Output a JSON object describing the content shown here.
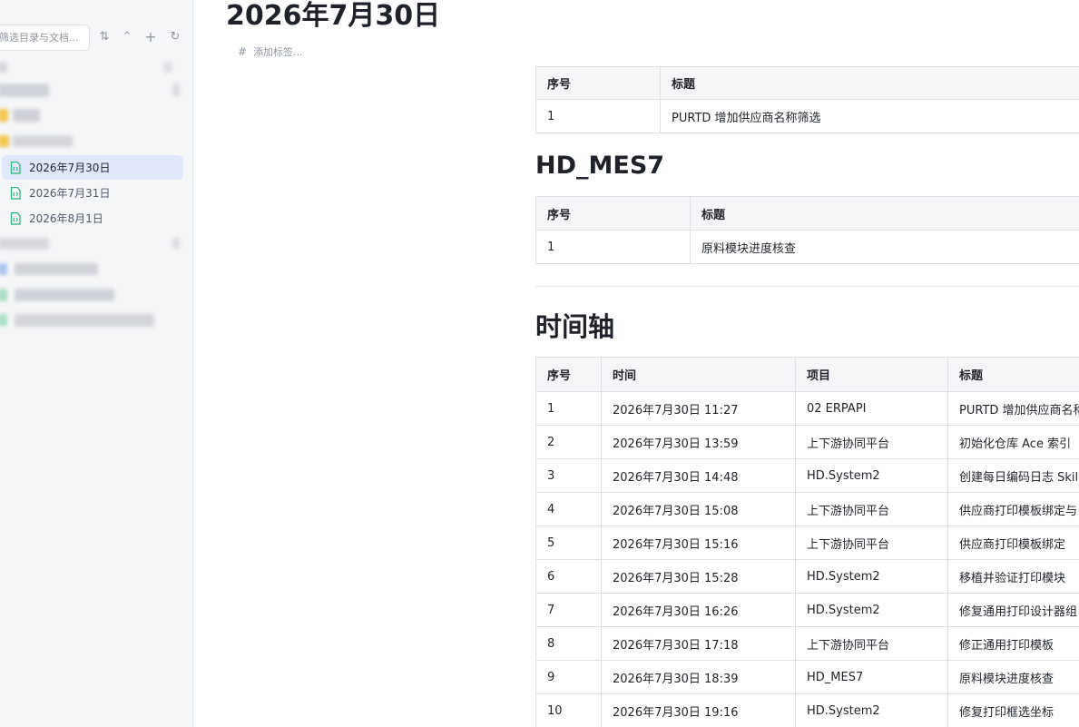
{
  "sidebar": {
    "search": {
      "placeholder": "筛选目录与文档..."
    },
    "docs": [
      {
        "label": "2026年7月30日",
        "active": true
      },
      {
        "label": "2026年7月31日",
        "active": false
      },
      {
        "label": "2026年8月1日",
        "active": false
      }
    ]
  },
  "page": {
    "title": "2026年7月30日",
    "add_tag": "添加标签..."
  },
  "table1": {
    "headers": [
      "序号",
      "标题"
    ],
    "rows": [
      [
        "1",
        "PURTD 增加供应商名称筛选"
      ]
    ]
  },
  "section2": {
    "heading": "HD_MES7",
    "headers": [
      "序号",
      "标题"
    ],
    "rows": [
      [
        "1",
        "原料模块进度核查"
      ]
    ]
  },
  "timeline": {
    "heading": "时间轴",
    "headers": [
      "序号",
      "时间",
      "项目",
      "标题"
    ],
    "rows": [
      [
        "1",
        "2026年7月30日 11:27",
        "02 ERPAPI",
        "PURTD 增加供应商名称筛选"
      ],
      [
        "2",
        "2026年7月30日 13:59",
        "上下游协同平台",
        "初始化仓库 Ace 索引"
      ],
      [
        "3",
        "2026年7月30日 14:48",
        "HD.System2",
        "创建每日编码日志 Skill"
      ],
      [
        "4",
        "2026年7月30日 15:08",
        "上下游协同平台",
        "供应商打印模板绑定与"
      ],
      [
        "5",
        "2026年7月30日 15:16",
        "上下游协同平台",
        "供应商打印模板绑定"
      ],
      [
        "6",
        "2026年7月30日 15:28",
        "HD.System2",
        "移植并验证打印模块"
      ],
      [
        "7",
        "2026年7月30日 16:26",
        "HD.System2",
        "修复通用打印设计器组"
      ],
      [
        "8",
        "2026年7月30日 17:18",
        "上下游协同平台",
        "修正通用打印模板"
      ],
      [
        "9",
        "2026年7月30日 18:39",
        "HD_MES7",
        "原料模块进度核查"
      ],
      [
        "10",
        "2026年7月30日 19:16",
        "HD.System2",
        "修复打印框选坐标"
      ]
    ]
  },
  "colors": {
    "active_bg": "#e1e7fb",
    "doc_icon": "#21b37a",
    "header_bg": "#f5f6f7",
    "border": "#dee0e3"
  }
}
